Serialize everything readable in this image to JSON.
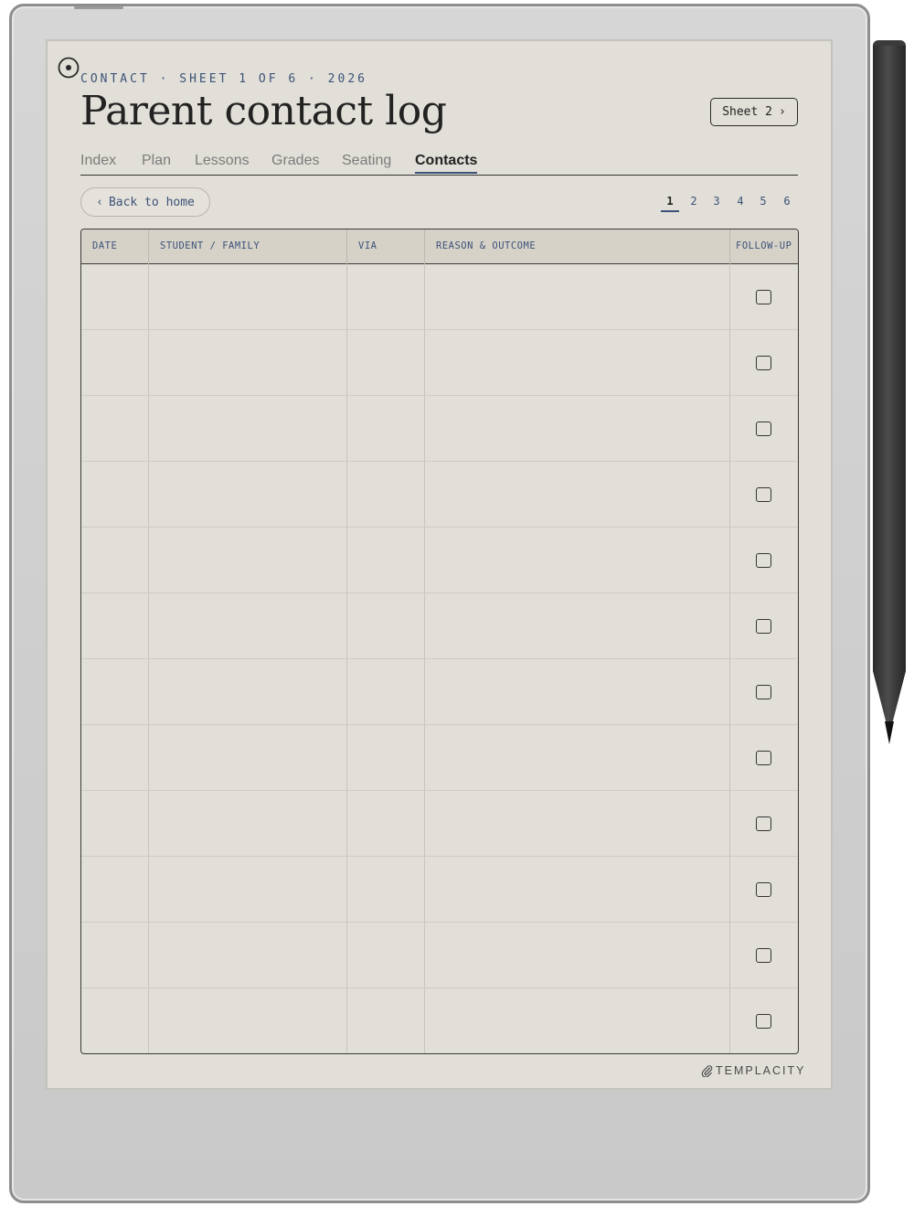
{
  "header": {
    "eyebrow": "CONTACT · SHEET 1 OF 6 · 2026",
    "title": "Parent contact log",
    "next_sheet_label": "Sheet 2",
    "next_sheet_chevron": "›"
  },
  "tabs": [
    {
      "label": "Index",
      "active": false
    },
    {
      "label": "Plan",
      "active": false
    },
    {
      "label": "Lessons",
      "active": false
    },
    {
      "label": "Grades",
      "active": false
    },
    {
      "label": "Seating",
      "active": false
    },
    {
      "label": "Contacts",
      "active": true
    }
  ],
  "nav": {
    "back_chevron": "‹",
    "back_label": "Back to home",
    "pages": [
      "1",
      "2",
      "3",
      "4",
      "5",
      "6"
    ],
    "current_page": "1"
  },
  "table": {
    "columns": [
      "DATE",
      "STUDENT / FAMILY",
      "VIA",
      "REASON & OUTCOME",
      "FOLLOW-UP"
    ],
    "rows": [
      {
        "date": "",
        "student_family": "",
        "via": "",
        "reason_outcome": "",
        "follow_up": false
      },
      {
        "date": "",
        "student_family": "",
        "via": "",
        "reason_outcome": "",
        "follow_up": false
      },
      {
        "date": "",
        "student_family": "",
        "via": "",
        "reason_outcome": "",
        "follow_up": false
      },
      {
        "date": "",
        "student_family": "",
        "via": "",
        "reason_outcome": "",
        "follow_up": false
      },
      {
        "date": "",
        "student_family": "",
        "via": "",
        "reason_outcome": "",
        "follow_up": false
      },
      {
        "date": "",
        "student_family": "",
        "via": "",
        "reason_outcome": "",
        "follow_up": false
      },
      {
        "date": "",
        "student_family": "",
        "via": "",
        "reason_outcome": "",
        "follow_up": false
      },
      {
        "date": "",
        "student_family": "",
        "via": "",
        "reason_outcome": "",
        "follow_up": false
      },
      {
        "date": "",
        "student_family": "",
        "via": "",
        "reason_outcome": "",
        "follow_up": false
      },
      {
        "date": "",
        "student_family": "",
        "via": "",
        "reason_outcome": "",
        "follow_up": false
      },
      {
        "date": "",
        "student_family": "",
        "via": "",
        "reason_outcome": "",
        "follow_up": false
      },
      {
        "date": "",
        "student_family": "",
        "via": "",
        "reason_outcome": "",
        "follow_up": false
      }
    ]
  },
  "footer": {
    "brand": "TEMPLACITY",
    "brand_icon": "paperclip-icon"
  },
  "icons": {
    "sync": "sync-circle-icon"
  },
  "colors": {
    "screen_bg": "#e2dfd8",
    "accent_blue": "#3d5278",
    "ink": "#222222",
    "header_row_bg": "#d6d2c8",
    "device_frame": "#d2d2d2"
  }
}
